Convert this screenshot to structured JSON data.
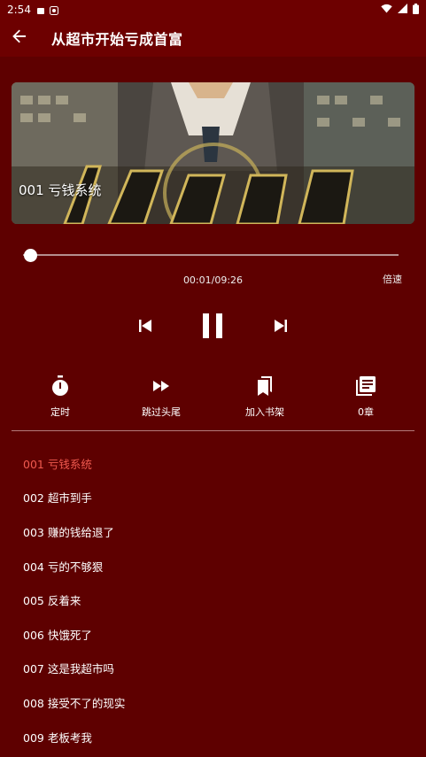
{
  "status_bar": {
    "time": "2:54"
  },
  "app_bar": {
    "title": "从超市开始亏成首富"
  },
  "cover": {
    "episode_title": "001 亏钱系统"
  },
  "player": {
    "progress": 0.0018,
    "time_display": "00:01/09:26",
    "speed_label": "倍速"
  },
  "actions": [
    {
      "label": "定时",
      "icon": "timer-icon"
    },
    {
      "label": "跳过头尾",
      "icon": "fast-forward-icon"
    },
    {
      "label": "加入书架",
      "icon": "bookmarks-icon"
    },
    {
      "label": "0章",
      "icon": "library-books-icon"
    }
  ],
  "chapters": [
    {
      "title": "001 亏钱系统",
      "active": true
    },
    {
      "title": "002 超市到手"
    },
    {
      "title": "003 赚的钱给退了"
    },
    {
      "title": "004 亏的不够狠"
    },
    {
      "title": "005 反着来"
    },
    {
      "title": "006 快饿死了"
    },
    {
      "title": "007 这是我超市吗"
    },
    {
      "title": "008 接受不了的现实"
    },
    {
      "title": "009 老板考我"
    }
  ],
  "colors": {
    "background": "#5e0000",
    "app_bar": "#6d0000",
    "active_chapter": "#f05a4f"
  }
}
